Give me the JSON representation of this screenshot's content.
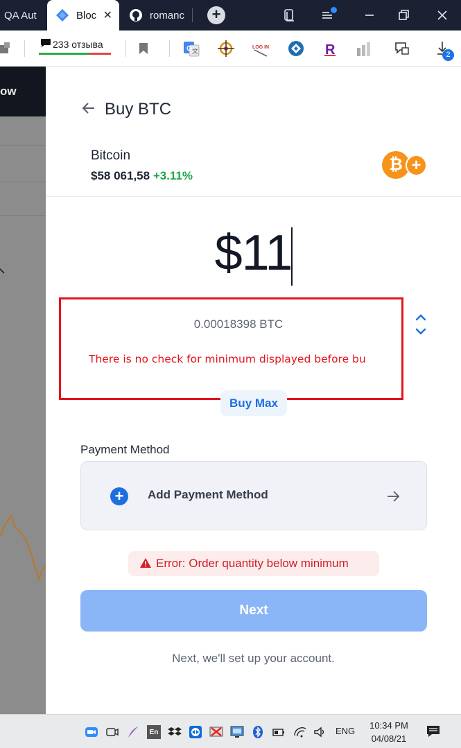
{
  "browser": {
    "tabs": [
      {
        "title": "QA Aut"
      },
      {
        "title": "Bloc",
        "active": true
      },
      {
        "title": "romanc"
      }
    ],
    "extensions": {
      "reviews_count": "233 отзыва",
      "login_ext_label": "LOG IN",
      "download_badge": "2"
    }
  },
  "background_page": {
    "header_text": "ow"
  },
  "modal": {
    "title": "Buy BTC",
    "asset": {
      "name": "Bitcoin",
      "price": "$58 061,58",
      "change": "+3.11%",
      "icon_symbol": "₿",
      "add_symbol": "+"
    },
    "amount": "$11",
    "btc_amount": "0.00018398 BTC",
    "annotation_note": "There is no check for minimum displayed before bu",
    "buy_max_label": "Buy Max",
    "payment_method": {
      "label": "Payment Method",
      "add_label": "Add Payment Method"
    },
    "error_text": "Error: Order quantity below minimum",
    "next_label": "Next",
    "footer_note": "Next, we'll set up your account."
  },
  "taskbar": {
    "language": "ENG",
    "time": "10:34 PM",
    "date": "04/08/21"
  },
  "colors": {
    "brand_blue": "#1d6fe0",
    "next_disabled": "#8ab6f7",
    "positive_green": "#1ea54e",
    "error_red": "#cf2027",
    "annotation_red": "#e3141b",
    "bitcoin_orange": "#f7931a"
  }
}
